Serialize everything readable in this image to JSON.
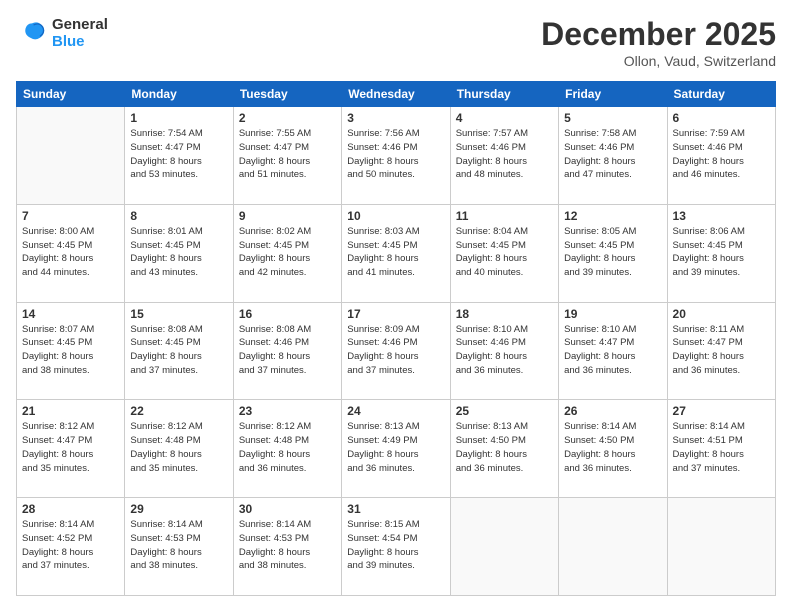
{
  "logo": {
    "line1": "General",
    "line2": "Blue"
  },
  "title": "December 2025",
  "location": "Ollon, Vaud, Switzerland",
  "days_header": [
    "Sunday",
    "Monday",
    "Tuesday",
    "Wednesday",
    "Thursday",
    "Friday",
    "Saturday"
  ],
  "weeks": [
    [
      {
        "day": "",
        "info": ""
      },
      {
        "day": "1",
        "info": "Sunrise: 7:54 AM\nSunset: 4:47 PM\nDaylight: 8 hours\nand 53 minutes."
      },
      {
        "day": "2",
        "info": "Sunrise: 7:55 AM\nSunset: 4:47 PM\nDaylight: 8 hours\nand 51 minutes."
      },
      {
        "day": "3",
        "info": "Sunrise: 7:56 AM\nSunset: 4:46 PM\nDaylight: 8 hours\nand 50 minutes."
      },
      {
        "day": "4",
        "info": "Sunrise: 7:57 AM\nSunset: 4:46 PM\nDaylight: 8 hours\nand 48 minutes."
      },
      {
        "day": "5",
        "info": "Sunrise: 7:58 AM\nSunset: 4:46 PM\nDaylight: 8 hours\nand 47 minutes."
      },
      {
        "day": "6",
        "info": "Sunrise: 7:59 AM\nSunset: 4:46 PM\nDaylight: 8 hours\nand 46 minutes."
      }
    ],
    [
      {
        "day": "7",
        "info": "Sunrise: 8:00 AM\nSunset: 4:45 PM\nDaylight: 8 hours\nand 44 minutes."
      },
      {
        "day": "8",
        "info": "Sunrise: 8:01 AM\nSunset: 4:45 PM\nDaylight: 8 hours\nand 43 minutes."
      },
      {
        "day": "9",
        "info": "Sunrise: 8:02 AM\nSunset: 4:45 PM\nDaylight: 8 hours\nand 42 minutes."
      },
      {
        "day": "10",
        "info": "Sunrise: 8:03 AM\nSunset: 4:45 PM\nDaylight: 8 hours\nand 41 minutes."
      },
      {
        "day": "11",
        "info": "Sunrise: 8:04 AM\nSunset: 4:45 PM\nDaylight: 8 hours\nand 40 minutes."
      },
      {
        "day": "12",
        "info": "Sunrise: 8:05 AM\nSunset: 4:45 PM\nDaylight: 8 hours\nand 39 minutes."
      },
      {
        "day": "13",
        "info": "Sunrise: 8:06 AM\nSunset: 4:45 PM\nDaylight: 8 hours\nand 39 minutes."
      }
    ],
    [
      {
        "day": "14",
        "info": "Sunrise: 8:07 AM\nSunset: 4:45 PM\nDaylight: 8 hours\nand 38 minutes."
      },
      {
        "day": "15",
        "info": "Sunrise: 8:08 AM\nSunset: 4:45 PM\nDaylight: 8 hours\nand 37 minutes."
      },
      {
        "day": "16",
        "info": "Sunrise: 8:08 AM\nSunset: 4:46 PM\nDaylight: 8 hours\nand 37 minutes."
      },
      {
        "day": "17",
        "info": "Sunrise: 8:09 AM\nSunset: 4:46 PM\nDaylight: 8 hours\nand 37 minutes."
      },
      {
        "day": "18",
        "info": "Sunrise: 8:10 AM\nSunset: 4:46 PM\nDaylight: 8 hours\nand 36 minutes."
      },
      {
        "day": "19",
        "info": "Sunrise: 8:10 AM\nSunset: 4:47 PM\nDaylight: 8 hours\nand 36 minutes."
      },
      {
        "day": "20",
        "info": "Sunrise: 8:11 AM\nSunset: 4:47 PM\nDaylight: 8 hours\nand 36 minutes."
      }
    ],
    [
      {
        "day": "21",
        "info": "Sunrise: 8:12 AM\nSunset: 4:47 PM\nDaylight: 8 hours\nand 35 minutes."
      },
      {
        "day": "22",
        "info": "Sunrise: 8:12 AM\nSunset: 4:48 PM\nDaylight: 8 hours\nand 35 minutes."
      },
      {
        "day": "23",
        "info": "Sunrise: 8:12 AM\nSunset: 4:48 PM\nDaylight: 8 hours\nand 36 minutes."
      },
      {
        "day": "24",
        "info": "Sunrise: 8:13 AM\nSunset: 4:49 PM\nDaylight: 8 hours\nand 36 minutes."
      },
      {
        "day": "25",
        "info": "Sunrise: 8:13 AM\nSunset: 4:50 PM\nDaylight: 8 hours\nand 36 minutes."
      },
      {
        "day": "26",
        "info": "Sunrise: 8:14 AM\nSunset: 4:50 PM\nDaylight: 8 hours\nand 36 minutes."
      },
      {
        "day": "27",
        "info": "Sunrise: 8:14 AM\nSunset: 4:51 PM\nDaylight: 8 hours\nand 37 minutes."
      }
    ],
    [
      {
        "day": "28",
        "info": "Sunrise: 8:14 AM\nSunset: 4:52 PM\nDaylight: 8 hours\nand 37 minutes."
      },
      {
        "day": "29",
        "info": "Sunrise: 8:14 AM\nSunset: 4:53 PM\nDaylight: 8 hours\nand 38 minutes."
      },
      {
        "day": "30",
        "info": "Sunrise: 8:14 AM\nSunset: 4:53 PM\nDaylight: 8 hours\nand 38 minutes."
      },
      {
        "day": "31",
        "info": "Sunrise: 8:15 AM\nSunset: 4:54 PM\nDaylight: 8 hours\nand 39 minutes."
      },
      {
        "day": "",
        "info": ""
      },
      {
        "day": "",
        "info": ""
      },
      {
        "day": "",
        "info": ""
      }
    ]
  ]
}
